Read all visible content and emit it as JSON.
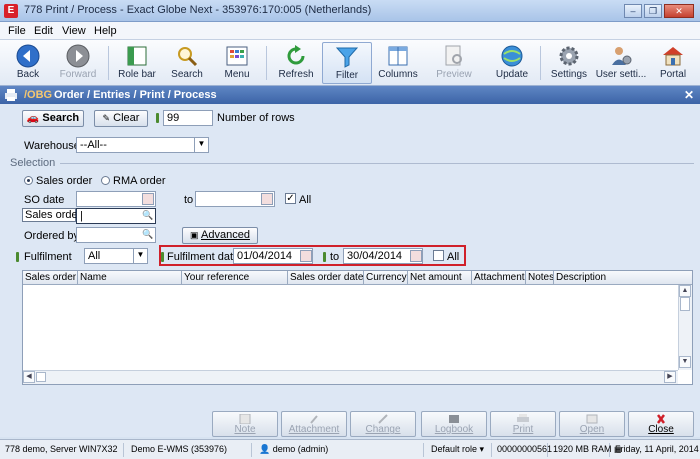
{
  "window": {
    "title": "778 Print / Process - Exact Globe Next - 353976:170:005 (Netherlands)",
    "app_icon_letter": "E",
    "controls": {
      "minimize": "–",
      "maximize": "❐",
      "close": "✕"
    }
  },
  "menu": [
    "File",
    "Edit",
    "View",
    "Help"
  ],
  "toolbar": [
    {
      "label": "Back",
      "icon": "back-arrow-icon",
      "enabled": true
    },
    {
      "label": "Forward",
      "icon": "forward-arrow-icon",
      "enabled": false
    },
    {
      "label": "Role bar",
      "icon": "role-bar-icon",
      "enabled": true
    },
    {
      "label": "Search",
      "icon": "magnifier-icon",
      "enabled": true
    },
    {
      "label": "Menu",
      "icon": "menu-grid-icon",
      "enabled": true
    },
    {
      "label": "Refresh",
      "icon": "refresh-icon",
      "enabled": true
    },
    {
      "label": "Filter",
      "icon": "filter-funnel-icon",
      "enabled": true,
      "active": true
    },
    {
      "label": "Columns",
      "icon": "columns-icon",
      "enabled": true
    },
    {
      "label": "Preview",
      "icon": "preview-icon",
      "enabled": false
    },
    {
      "label": "Update",
      "icon": "update-globe-icon",
      "enabled": true
    },
    {
      "label": "Settings",
      "icon": "gears-icon",
      "enabled": true
    },
    {
      "label": "User setti...",
      "icon": "user-settings-icon",
      "enabled": true
    },
    {
      "label": "Portal",
      "icon": "portal-house-icon",
      "enabled": true
    }
  ],
  "header": {
    "prefix": "/OBG",
    "path": "Order / Entries / Print / Process",
    "close": "✕"
  },
  "search_bar": {
    "search_label": "Search",
    "clear_label": "Clear",
    "rows_value": "99",
    "rows_label": "Number of rows"
  },
  "filters": {
    "warehouse_label": "Warehouse",
    "warehouse_value": "--All--",
    "selection_title": "Selection",
    "radio_sales": "Sales order",
    "radio_rma": "RMA order",
    "so_date_label": "SO date",
    "so_date_from": "",
    "to_label": "to",
    "so_date_to": "",
    "all_label": "All",
    "all_checked": true,
    "sales_order_label": "Sales order",
    "sales_order_value": "|",
    "ordered_by_label": "Ordered by",
    "ordered_by_value": "",
    "advanced_label": "Advanced",
    "fulfilment_label": "Fulfilment",
    "fulfilment_value": "All",
    "fulfilment_date_label": "Fulfilment date",
    "fulfilment_from": "01/04/2014",
    "fulfilment_to_label": "to",
    "fulfilment_to": "30/04/2014",
    "fulfilment_all_label": "All",
    "fulfilment_all_checked": false
  },
  "grid": {
    "columns": [
      "Sales order",
      "Name",
      "Your reference",
      "Sales order date",
      "Currency",
      "Net amount",
      "Attachment",
      "Notes",
      "Description"
    ]
  },
  "bottom_buttons": [
    {
      "label": "Note",
      "icon": "note-icon",
      "enabled": false
    },
    {
      "label": "Attachment",
      "icon": "paperclip-icon",
      "enabled": false
    },
    {
      "label": "Change",
      "icon": "pencil-icon",
      "enabled": false
    },
    {
      "label": "Logbook",
      "icon": "logbook-icon",
      "enabled": false
    },
    {
      "label": "Print",
      "icon": "printer-icon",
      "enabled": false
    },
    {
      "label": "Open",
      "icon": "open-icon",
      "enabled": false
    },
    {
      "label": "Close",
      "icon": "close-x-icon",
      "enabled": true
    }
  ],
  "status": {
    "server": "778 demo, Server WIN7X32",
    "company": "Demo E-WMS (353976)",
    "user": "demo (admin)",
    "role": "Default role",
    "number": "00000000561",
    "memory": "1920 MB RAM",
    "date": "Friday, 11 April, 2014"
  },
  "colors": {
    "accent": "#3c64a7",
    "highlight_box": "#d0202a",
    "required_marker": "#4b8a2f"
  }
}
